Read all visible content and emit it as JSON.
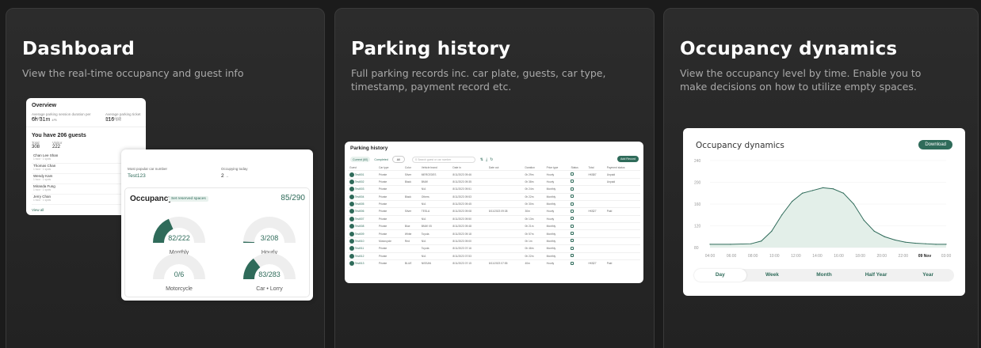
{
  "cards": [
    {
      "title": "Dashboard",
      "desc": "View the real-time occupancy and guest info"
    },
    {
      "title": "Parking history",
      "desc": "Full parking records inc. car plate, guests, car type, timestamp, payment record etc."
    },
    {
      "title": "Occupancy dynamics",
      "desc": "View the occupancy level by time.  Enable you to make decisions on how to utilize empty spaces."
    }
  ],
  "dashboard": {
    "overview_title": "Overview",
    "avg_parking_label": "Average parking session duration per month",
    "avg_parking_value": "6h 31m",
    "avg_parking_unit": "±%",
    "avg_paid_label": "Average parking ticket per month",
    "avg_paid_value": "116",
    "avg_paid_unit": "±%",
    "guests_title": "You have 206 guests",
    "guests_col1": "Total",
    "guests_col2": "Visitor",
    "guests_total": "308",
    "guests_visitor": "222",
    "guests": [
      {
        "name": "Chan Lee Shan",
        "sub": "1 hour · 1 spots"
      },
      {
        "name": "Thomas Chan",
        "sub": "1 hour · 1 spots"
      },
      {
        "name": "Wendy Kam",
        "sub": "1 hour · 1 spots"
      },
      {
        "name": "Miranda Fung",
        "sub": "1 hour · 1 spots"
      },
      {
        "name": "Jerry Chan",
        "sub": "1 hour · 1 spots"
      }
    ],
    "view_all": "View all",
    "popular_label": "Most popular car number",
    "popular_value": "Test123",
    "occupying_label": "Occupying today",
    "occupying_value": "2",
    "occupying_unit": "→",
    "occupancy_title": "Occupancy",
    "reserved_link": "Set reserved spaces",
    "occupancy_total": "85/290",
    "gauges": [
      {
        "value": "82/222",
        "label": "Monthly",
        "fraction": 0.37
      },
      {
        "value": "3/208",
        "label": "Hourly",
        "fraction": 0.014
      },
      {
        "value": "0/6",
        "label": "Motorcycle",
        "fraction": 0.0
      },
      {
        "value": "83/283",
        "label": "Car • Lorry",
        "fraction": 0.29
      }
    ]
  },
  "history": {
    "title": "Parking history",
    "filters": [
      "Current (60)",
      "Completed",
      "All"
    ],
    "search_placeholder": "Search guest or car number",
    "add_button": "Add Record",
    "columns": [
      "Guest",
      "Car type",
      "Color",
      "Vehicle brand",
      "Date in",
      "Date out",
      "Duration",
      "Price type",
      "Status",
      "Total",
      "Payment status"
    ],
    "rows": [
      {
        "plate": "Test001",
        "type": "Private",
        "color": "Silver",
        "brand": "MERCEDES",
        "in": "8/11/2023 09:46",
        "out": "",
        "dur": "0h 29m",
        "price": "Hourly",
        "total": "HK$87",
        "pay": "Unpaid"
      },
      {
        "plate": "Test002",
        "type": "Private",
        "color": "Black",
        "brand": "BMW",
        "in": "8/11/2023 09:35",
        "out": "",
        "dur": "0h 38m",
        "price": "Hourly",
        "total": "",
        "pay": "Unpaid"
      },
      {
        "plate": "Test003",
        "type": "Private",
        "color": "",
        "brand": "N/A",
        "in": "8/11/2023 09:51",
        "out": "",
        "dur": "0h 24m",
        "price": "Monthly",
        "total": "",
        "pay": ""
      },
      {
        "plate": "Test004",
        "type": "Private",
        "color": "Black",
        "brand": "Others",
        "in": "8/11/2023 09:53",
        "out": "",
        "dur": "0h 22m",
        "price": "Monthly",
        "total": "",
        "pay": ""
      },
      {
        "plate": "Test005",
        "type": "Private",
        "color": "",
        "brand": "N/A",
        "in": "8/11/2023 09:45",
        "out": "",
        "dur": "0h 30m",
        "price": "Monthly",
        "total": "",
        "pay": ""
      },
      {
        "plate": "Test006",
        "type": "Private",
        "color": "Silver",
        "brand": "TESLA",
        "in": "8/11/2023 09:08",
        "out": "8/11/2023 09:38",
        "dur": "30m",
        "price": "Hourly",
        "total": "HK$27",
        "pay": "Paid"
      },
      {
        "plate": "Test007",
        "type": "Private",
        "color": "",
        "brand": "N/A",
        "in": "8/11/2023 09:50",
        "out": "",
        "dur": "0h 13m",
        "price": "Hourly",
        "total": "",
        "pay": ""
      },
      {
        "plate": "Test008",
        "type": "Private",
        "color": "Blue",
        "brand": "BMW X5",
        "in": "8/11/2023 09:48",
        "out": "",
        "dur": "0h 21m",
        "price": "Monthly",
        "total": "",
        "pay": ""
      },
      {
        "plate": "Test009",
        "type": "Private",
        "color": "White",
        "brand": "Toyota",
        "in": "8/11/2023 09:18",
        "out": "",
        "dur": "0h 57m",
        "price": "Monthly",
        "total": "",
        "pay": ""
      },
      {
        "plate": "Test010",
        "type": "Motorcycle",
        "color": "Red",
        "brand": "N/A",
        "in": "8/11/2023 09:00",
        "out": "",
        "dur": "0h 1m",
        "price": "Monthly",
        "total": "",
        "pay": ""
      },
      {
        "plate": "Test011",
        "type": "Private",
        "color": "",
        "brand": "Toyota",
        "in": "8/11/2023 07:16",
        "out": "",
        "dur": "0h 46m",
        "price": "Monthly",
        "total": "",
        "pay": ""
      },
      {
        "plate": "Test012",
        "type": "Private",
        "color": "",
        "brand": "N/A",
        "in": "8/11/2023 07:53",
        "out": "",
        "dur": "0h 22m",
        "price": "Monthly",
        "total": "",
        "pay": ""
      },
      {
        "plate": "Test013",
        "type": "Private",
        "color": "BLUE",
        "brand": "NISSAN",
        "in": "8/11/2023 07:15",
        "out": "8/11/2023 07:55",
        "dur": "40m",
        "price": "Hourly",
        "total": "HK$27",
        "pay": "Paid"
      }
    ]
  },
  "occupancy": {
    "title": "Occupancy dynamics",
    "download_button": "Download",
    "tabs": [
      "Day",
      "Week",
      "Month",
      "Half Year",
      "Year"
    ],
    "selected_tab": "Day"
  },
  "chart_data": {
    "type": "line",
    "title": "Occupancy dynamics",
    "y_ticks": [
      "240",
      "200",
      "160",
      "120",
      "80"
    ],
    "ylim": [
      80,
      240
    ],
    "x_ticks": [
      "04:00",
      "06:00",
      "08:00",
      "10:00",
      "12:00",
      "14:00",
      "16:00",
      "18:00",
      "20:00",
      "22:00",
      "09 Nov",
      "03:00"
    ],
    "x": [
      0,
      2,
      4,
      5,
      6,
      7,
      8,
      9,
      10,
      11,
      12,
      13,
      14,
      15,
      16,
      17,
      18,
      19,
      20,
      21,
      22,
      23
    ],
    "values": [
      86,
      86,
      87,
      92,
      110,
      140,
      165,
      180,
      185,
      190,
      188,
      180,
      160,
      130,
      110,
      100,
      94,
      90,
      88,
      87,
      86,
      86
    ],
    "series_color": "#2f6b5a",
    "fill_color": "#e3efe9",
    "grid": true
  }
}
